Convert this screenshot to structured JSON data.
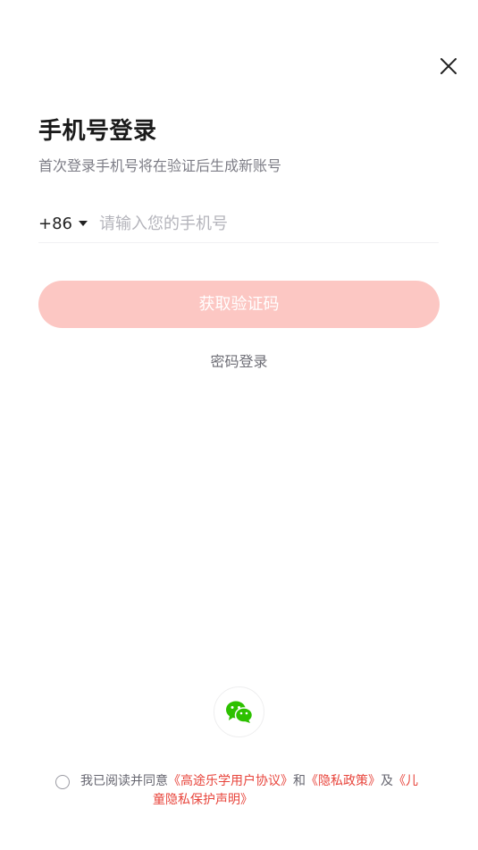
{
  "title": "手机号登录",
  "subtitle": "首次登录手机号将在验证后生成新账号",
  "phone": {
    "country_code": "+86",
    "value": "",
    "placeholder": "请输入您的手机号"
  },
  "get_code_button": "获取验证码",
  "password_login": "密码登录",
  "agreement": {
    "prefix": "我已阅读并同意",
    "user_agreement": "《高途乐学用户协议》",
    "and": "和",
    "privacy_policy": "《隐私政策》",
    "also": "及",
    "child_privacy_part1": "《儿",
    "child_privacy_part2": "童隐私保护声明》",
    "checked": false
  },
  "icons": {
    "close": "close-icon",
    "caret": "caret-down-icon",
    "wechat": "wechat-icon"
  },
  "colors": {
    "accent": "#e8453c",
    "button_disabled": "#fcc7c3",
    "wechat_green": "#2dc100"
  }
}
